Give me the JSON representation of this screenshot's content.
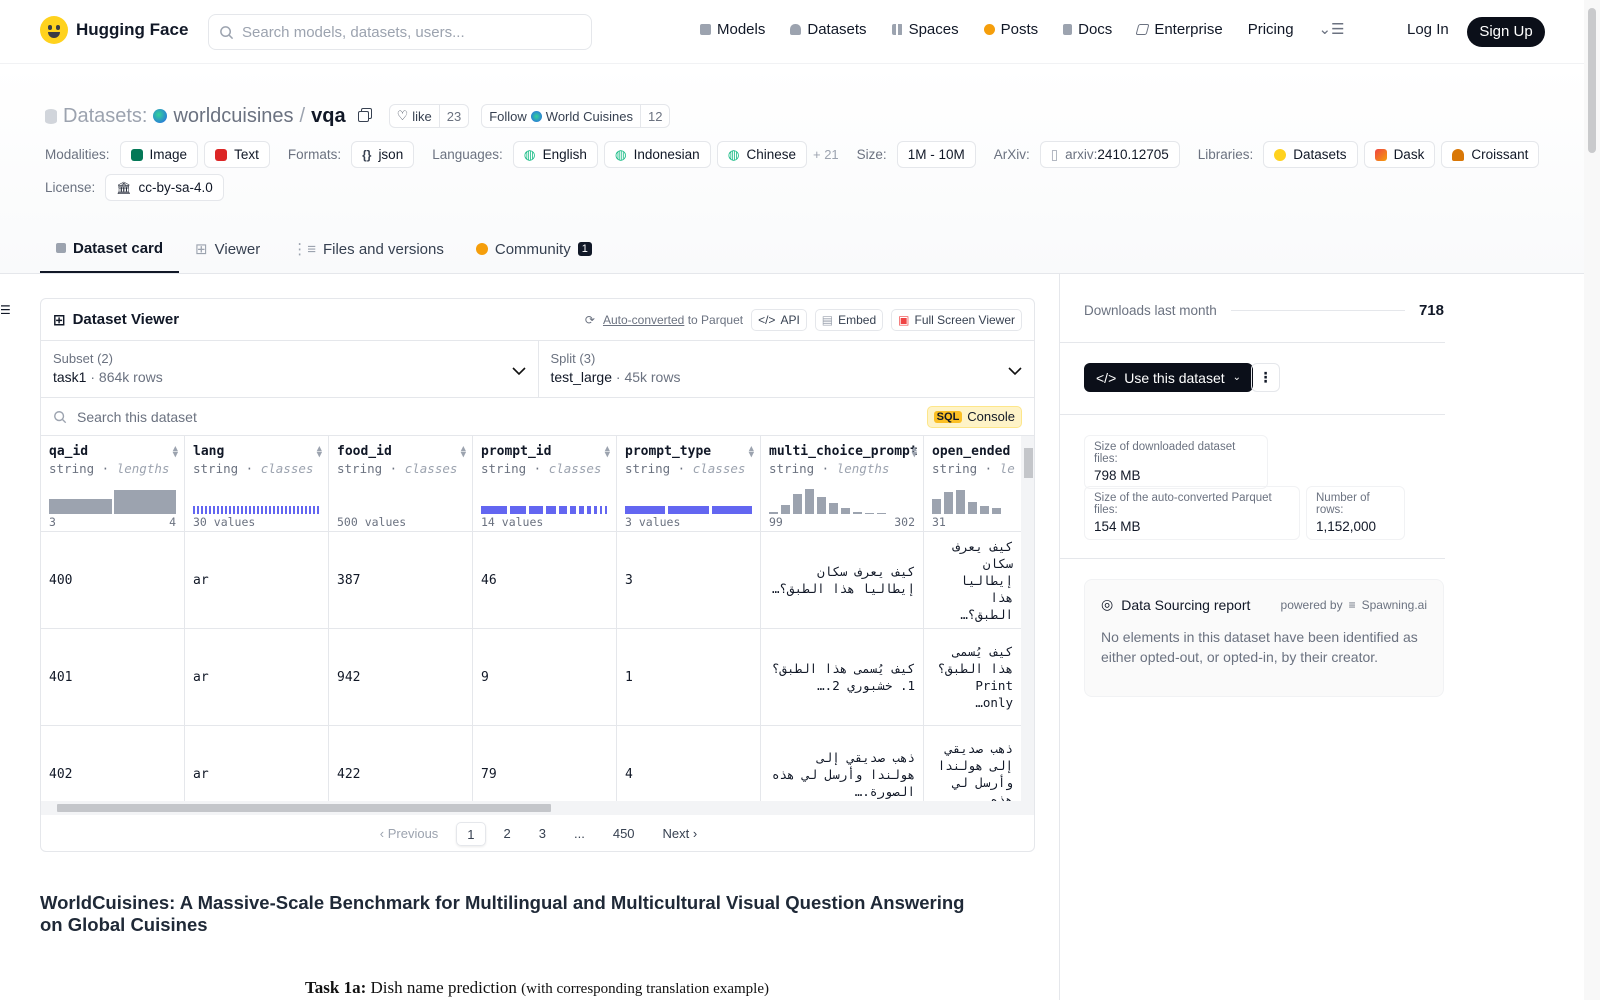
{
  "nav": {
    "brand": "Hugging Face",
    "search_placeholder": "Search models, datasets, users...",
    "links": [
      "Models",
      "Datasets",
      "Spaces",
      "Posts",
      "Docs",
      "Enterprise",
      "Pricing"
    ],
    "login": "Log In",
    "signup": "Sign Up"
  },
  "repo": {
    "section": "Datasets:",
    "org": "worldcuisines",
    "separator": "/",
    "name": "vqa",
    "like_label": "like",
    "like_count": "23",
    "follow_label": "Follow",
    "follow_org": "World Cuisines",
    "follow_count": "12"
  },
  "meta": {
    "modalities_label": "Modalities:",
    "modalities": [
      "Image",
      "Text"
    ],
    "formats_label": "Formats:",
    "formats": [
      "json"
    ],
    "languages_label": "Languages:",
    "languages": [
      "English",
      "Indonesian",
      "Chinese"
    ],
    "languages_more": "+ 21",
    "size_label": "Size:",
    "size": "1M - 10M",
    "arxiv_label": "ArXiv:",
    "arxiv_prefix": "arxiv:",
    "arxiv_id": "2410.12705",
    "libraries_label": "Libraries:",
    "libraries": [
      "Datasets",
      "Dask",
      "Croissant"
    ],
    "license_label": "License:",
    "license": "cc-by-sa-4.0"
  },
  "tabs": [
    {
      "label": "Dataset card",
      "active": true
    },
    {
      "label": "Viewer"
    },
    {
      "label": "Files and versions"
    },
    {
      "label": "Community",
      "badge": "1"
    }
  ],
  "viewer": {
    "title": "Dataset Viewer",
    "auto_converted": "Auto-converted",
    "to_parquet": "to Parquet",
    "api": "API",
    "embed": "Embed",
    "full_screen": "Full Screen Viewer",
    "subset_label": "Subset (2)",
    "subset_value": "task1",
    "subset_rows": "864k rows",
    "split_label": "Split (3)",
    "split_value": "test_large",
    "split_rows": "45k rows",
    "search_placeholder": "Search this dataset",
    "sql": "SQL",
    "console": "Console",
    "columns": [
      {
        "name": "qa_id",
        "type": "string",
        "kind": "lengths",
        "foot_left": "3",
        "foot_right": "4"
      },
      {
        "name": "lang",
        "type": "string",
        "kind": "classes",
        "foot_left": "30 values",
        "foot_right": ""
      },
      {
        "name": "food_id",
        "type": "string",
        "kind": "classes",
        "foot_left": "500 values",
        "foot_right": ""
      },
      {
        "name": "prompt_id",
        "type": "string",
        "kind": "classes",
        "foot_left": "14 values",
        "foot_right": ""
      },
      {
        "name": "prompt_type",
        "type": "string",
        "kind": "classes",
        "foot_left": "3 values",
        "foot_right": ""
      },
      {
        "name": "multi_choice_prompt",
        "type": "string",
        "kind": "lengths",
        "foot_left": "99",
        "foot_right": "302"
      },
      {
        "name": "open_ended",
        "type": "string",
        "kind": "le",
        "foot_left": "31",
        "foot_right": ""
      }
    ],
    "rows": [
      [
        "400",
        "ar",
        "387",
        "46",
        "3",
        "كيف يعرف سكان إيطاليا هذا الطبق؟…",
        "كيف يعرف سكان إيطاليا هذا الطبق؟…"
      ],
      [
        "401",
        "ar",
        "942",
        "9",
        "1",
        "كيف يُسمى هذا الطبق؟ 1. خشبوري 2.…",
        "كيف يُسمى هذا الطبق؟ Print only…"
      ],
      [
        "402",
        "ar",
        "422",
        "79",
        "4",
        "ذهب صديقي إلى هولندا وأرسل لي هذه الصورة.…",
        "ذهب صديقي إلى هولندا وأرسل لي هذه…"
      ]
    ],
    "pager": {
      "prev": "Previous",
      "pages": [
        "1",
        "2",
        "3",
        "...",
        "450"
      ],
      "next": "Next"
    }
  },
  "card": {
    "title": "WorldCuisines: A Massive-Scale Benchmark for Multilingual and Multicultural Visual Question Answering on Global Cuisines",
    "task_bold": "Task 1a:",
    "task_text": "Dish name prediction",
    "task_small": "(with corresponding translation example)"
  },
  "sidebar": {
    "downloads_label": "Downloads last month",
    "downloads": "718",
    "use_button": "Use this dataset",
    "size_dl_label": "Size of downloaded dataset files:",
    "size_dl": "798 MB",
    "size_pq_label": "Size of the auto-converted Parquet files:",
    "size_pq": "154 MB",
    "rows_label": "Number of rows:",
    "rows": "1,152,000",
    "dsr_title": "Data Sourcing report",
    "dsr_powered": "powered by",
    "dsr_vendor": "Spawning.ai",
    "dsr_text": "No elements in this dataset have been identified as either opted-out, or opted-in, by their creator."
  },
  "colors": {
    "accent": "#6366f1",
    "dark": "#0b0f19",
    "sql": "#fbbf24"
  }
}
